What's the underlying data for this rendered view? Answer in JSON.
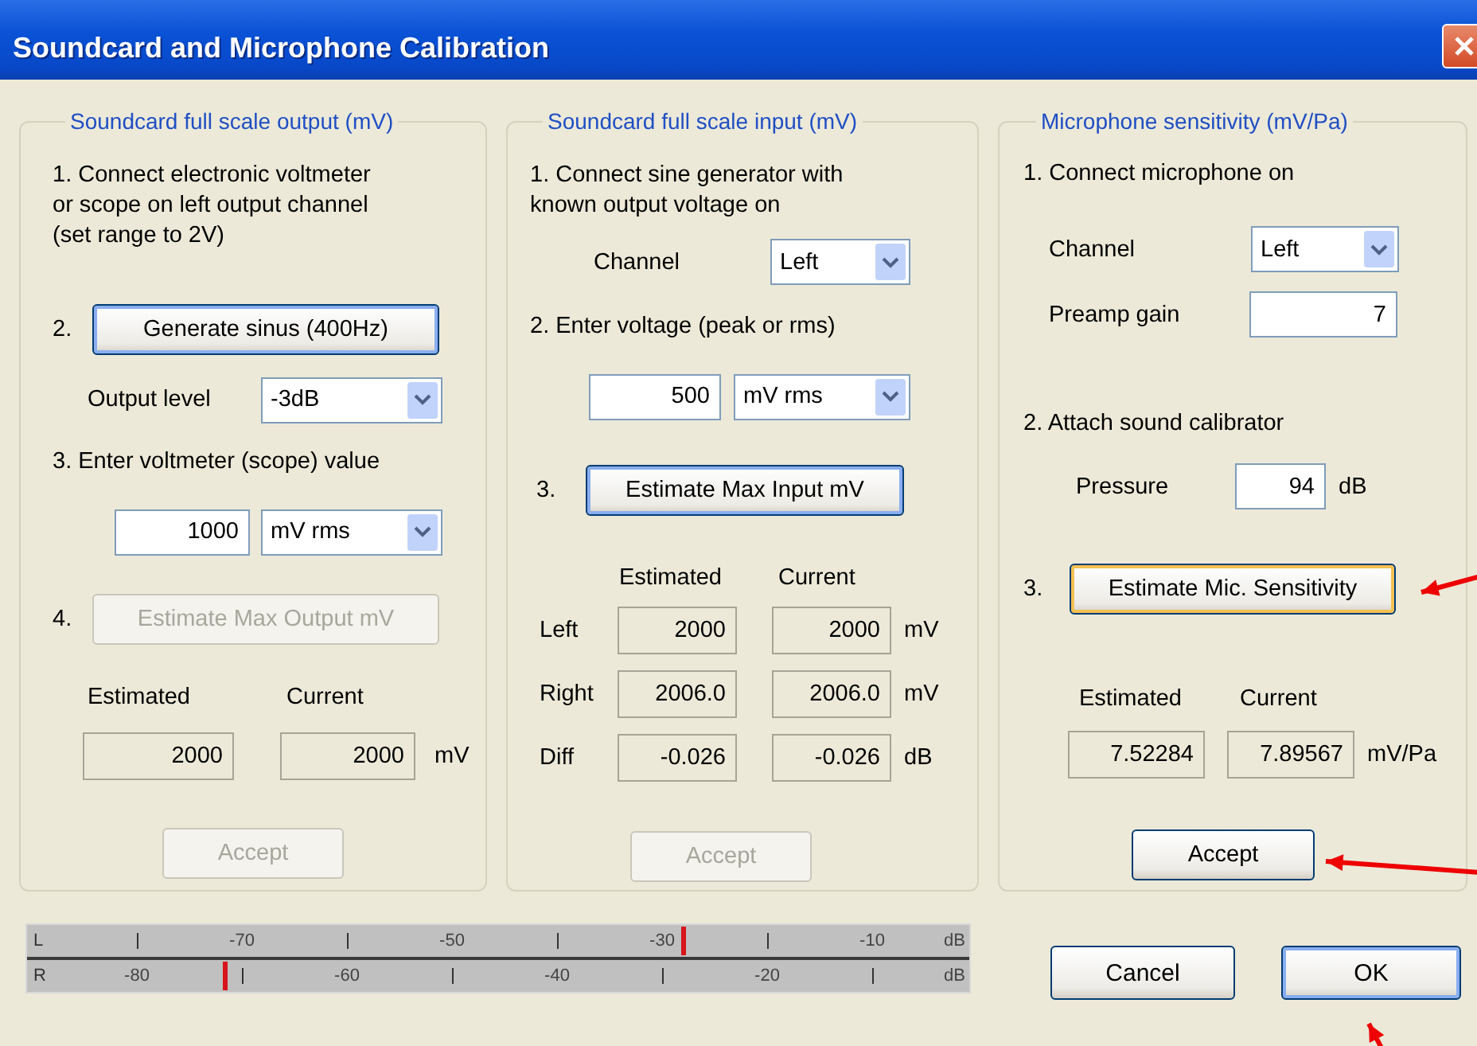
{
  "window": {
    "title": "Soundcard and Microphone Calibration"
  },
  "output_panel": {
    "title": "Soundcard full scale output (mV)",
    "step1": "1. Connect electronic voltmeter\nor scope on left output channel\n(set range  to 2V)",
    "step2_number": "2.",
    "generate_button": {
      "label": "Generate sinus (400Hz)",
      "disabled": false,
      "focused": true,
      "hovered": false
    },
    "output_level": {
      "label": "Output level",
      "value": "-3dB"
    },
    "step3": "3. Enter voltmeter (scope) value",
    "voltmeter_value": "1000",
    "voltmeter_unit": "mV rms",
    "step4_number": "4.",
    "estimate_button": {
      "label": "Estimate Max Output mV",
      "disabled": true,
      "focused": false,
      "hovered": false
    },
    "estimated_header": "Estimated",
    "current_header": "Current",
    "estimated": "2000",
    "current": "2000",
    "unit": "mV",
    "accept_button": {
      "label": "Accept",
      "disabled": true,
      "focused": false,
      "hovered": false
    }
  },
  "input_panel": {
    "title": "Soundcard full scale  input (mV)",
    "step1": "1. Connect sine generator with\nknown output voltage on",
    "channel": {
      "label": "Channel",
      "value": "Left"
    },
    "step2": "2. Enter voltage (peak or rms)",
    "voltage_value": "500",
    "voltage_unit": "mV rms",
    "step3_number": "3.",
    "estimate_button": {
      "label": "Estimate Max Input mV",
      "disabled": false,
      "focused": true,
      "hovered": false
    },
    "estimated_header": "Estimated",
    "current_header": "Current",
    "rows": [
      {
        "label": "Left",
        "estimated": "2000",
        "current": "2000",
        "unit": "mV"
      },
      {
        "label": "Right",
        "estimated": "2006.0",
        "current": "2006.0",
        "unit": "mV"
      },
      {
        "label": "Diff",
        "estimated": "-0.026",
        "current": "-0.026",
        "unit": "dB"
      }
    ],
    "accept_button": {
      "label": "Accept",
      "disabled": true,
      "focused": false,
      "hovered": false
    }
  },
  "mic_panel": {
    "title": "Microphone sensitivity (mV/Pa)",
    "step1": "1. Connect microphone on",
    "channel": {
      "label": "Channel",
      "value": "Left"
    },
    "preamp_gain": {
      "label": "Preamp  gain",
      "value": "7"
    },
    "step2": "2. Attach sound calibrator",
    "pressure": {
      "label": "Pressure",
      "value": "94",
      "unit": "dB"
    },
    "step3_number": "3.",
    "estimate_button": {
      "label": "Estimate Mic. Sensitivity",
      "disabled": false,
      "focused": false,
      "hovered": true
    },
    "estimated_header": "Estimated",
    "current_header": "Current",
    "estimated": "7.52284",
    "current": "7.89567",
    "unit": "mV/Pa",
    "accept_button": {
      "label": "Accept",
      "disabled": false,
      "focused": false,
      "hovered": false
    }
  },
  "meter": {
    "rows": [
      {
        "channel": "L",
        "level": 0.694,
        "scale": [
          {
            "kind": "tick"
          },
          {
            "kind": "label",
            "text": "-70"
          },
          {
            "kind": "tick"
          },
          {
            "kind": "label",
            "text": "-50"
          },
          {
            "kind": "tick"
          },
          {
            "kind": "label",
            "text": "-30"
          },
          {
            "kind": "tick"
          },
          {
            "kind": "label",
            "text": "-10"
          }
        ],
        "unit": "dB"
      },
      {
        "channel": "R",
        "level": 0.207,
        "scale": [
          {
            "kind": "label",
            "text": "-80"
          },
          {
            "kind": "tick"
          },
          {
            "kind": "label",
            "text": "-60"
          },
          {
            "kind": "tick"
          },
          {
            "kind": "label",
            "text": "-40"
          },
          {
            "kind": "tick"
          },
          {
            "kind": "label",
            "text": "-20"
          },
          {
            "kind": "tick"
          }
        ],
        "unit": "dB"
      }
    ]
  },
  "buttons": [
    {
      "label": "Cancel",
      "focused": false
    },
    {
      "label": "OK",
      "focused": true
    }
  ]
}
